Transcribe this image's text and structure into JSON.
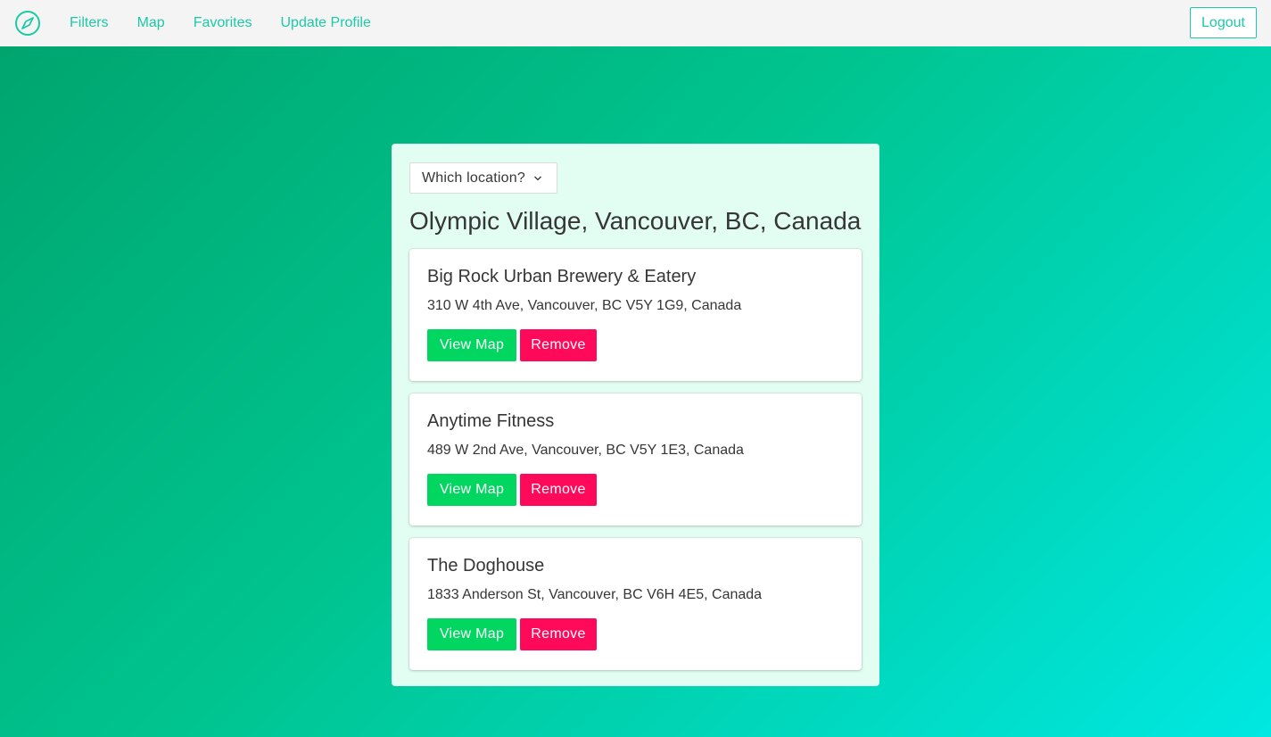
{
  "nav": {
    "logo_icon": "compass-icon",
    "links": [
      "Filters",
      "Map",
      "Favorites",
      "Update Profile"
    ],
    "logout_label": "Logout"
  },
  "panel": {
    "location_select": {
      "label": "Which location?",
      "icon": "chevron-down-icon"
    },
    "location_title": "Olympic Village, Vancouver, BC, Canada",
    "places": [
      {
        "name": "Big Rock Urban Brewery & Eatery",
        "address": "310 W 4th Ave, Vancouver, BC V5Y 1G9, Canada",
        "view_map_label": "View Map",
        "remove_label": "Remove"
      },
      {
        "name": "Anytime Fitness",
        "address": "489 W 2nd Ave, Vancouver, BC V5Y 1E3, Canada",
        "view_map_label": "View Map",
        "remove_label": "Remove"
      },
      {
        "name": "The Doghouse",
        "address": "1833 Anderson St, Vancouver, BC V6H 4E5, Canada",
        "view_map_label": "View Map",
        "remove_label": "Remove"
      }
    ]
  },
  "colors": {
    "accent": "#1ec9a6",
    "view_map": "#00d660",
    "remove": "#ff0a5a",
    "panel_bg": "#e2fdf1"
  }
}
